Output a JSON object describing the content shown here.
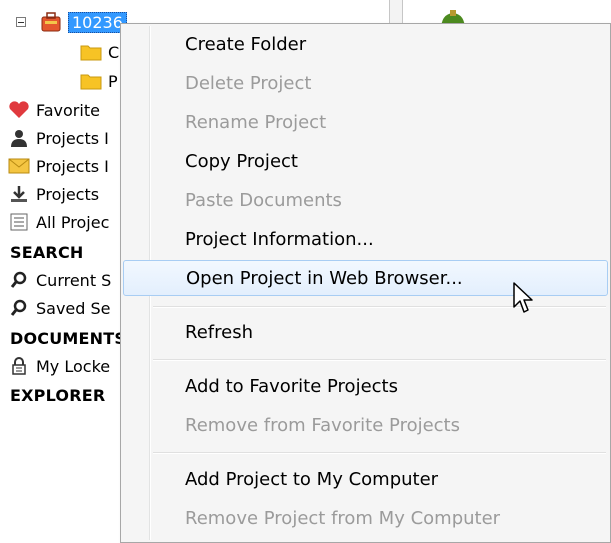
{
  "tree": {
    "root": {
      "label": "10236"
    },
    "children": [
      {
        "label": "C"
      },
      {
        "label": "P"
      }
    ],
    "items": [
      {
        "label": "Favorite",
        "icon": "heart-icon"
      },
      {
        "label": "Projects I",
        "icon": "person-icon"
      },
      {
        "label": "Projects I",
        "icon": "envelope-icon"
      },
      {
        "label": "Projects ",
        "icon": "download-icon"
      },
      {
        "label": "All Projec",
        "icon": "list-icon"
      }
    ],
    "search_header": "SEARCH",
    "search_items": [
      {
        "label": "Current S",
        "icon": "search-icon"
      },
      {
        "label": "Saved Se",
        "icon": "search-icon"
      }
    ],
    "documents_header": "DOCUMENTS",
    "documents_items": [
      {
        "label": "My Locke",
        "icon": "lock-icon"
      }
    ],
    "explorer_header": "EXPLORER"
  },
  "context_menu": {
    "items": [
      {
        "label": "Create Folder",
        "enabled": true
      },
      {
        "label": "Delete Project",
        "enabled": false
      },
      {
        "label": "Rename Project",
        "enabled": false
      },
      {
        "label": "Copy Project",
        "enabled": true
      },
      {
        "label": "Paste Documents",
        "enabled": false
      },
      {
        "label": "Project Information...",
        "enabled": true
      },
      {
        "label": "Open Project in Web Browser...",
        "enabled": true,
        "highlighted": true
      },
      {
        "label": "Refresh",
        "enabled": true
      },
      {
        "label": "Add to Favorite Projects",
        "enabled": true
      },
      {
        "label": "Remove from Favorite Projects",
        "enabled": false
      },
      {
        "label": "Add Project to My Computer",
        "enabled": true
      },
      {
        "label": "Remove Project from My Computer",
        "enabled": false
      }
    ]
  },
  "colors": {
    "selection": "#3399ff",
    "menu_bg": "#f5f5f5",
    "disabled_text": "#9b9b9b",
    "hover_border": "#a8cdf3",
    "folder": "#f7c325",
    "heart": "#e0393e"
  }
}
